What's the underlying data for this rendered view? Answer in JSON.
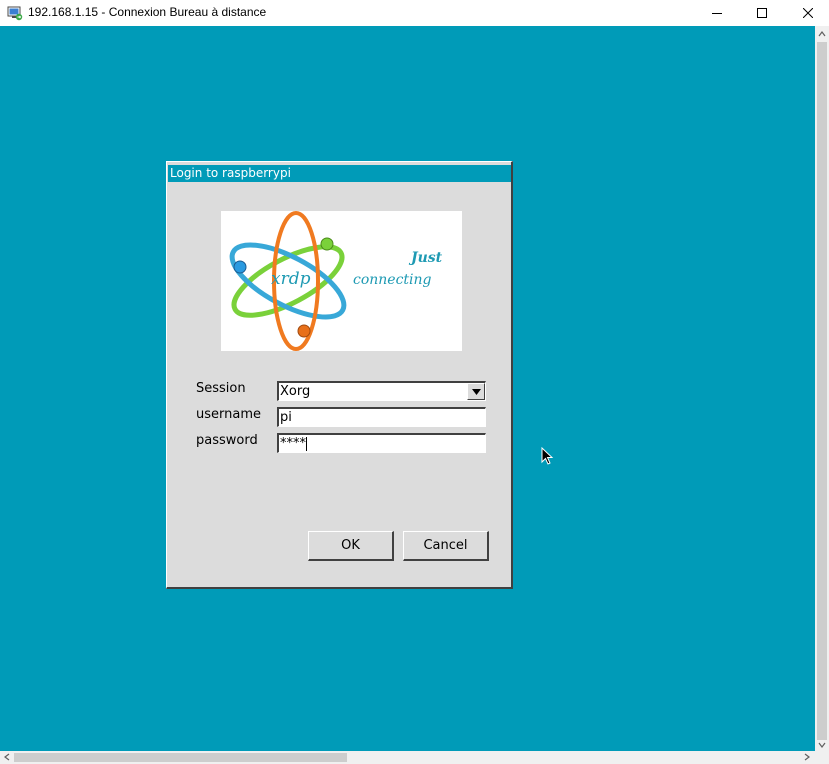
{
  "window": {
    "title": "192.168.1.15 - Connexion Bureau à distance",
    "icon": "remote-desktop-icon",
    "controls": [
      "minimize-icon",
      "maximize-icon",
      "close-icon"
    ]
  },
  "desktop": {
    "background_color": "#009bb8"
  },
  "dialog": {
    "title": "Login to raspberrypi",
    "logo": {
      "brand": "xrdp",
      "tagline_line1": "Just",
      "tagline_line2": "connecting"
    },
    "fields": {
      "session_label": "Session",
      "session_value": "Xorg",
      "username_label": "username",
      "username_value": "pi",
      "password_label": "password",
      "password_value": "****"
    },
    "buttons": {
      "ok": "OK",
      "cancel": "Cancel"
    }
  }
}
